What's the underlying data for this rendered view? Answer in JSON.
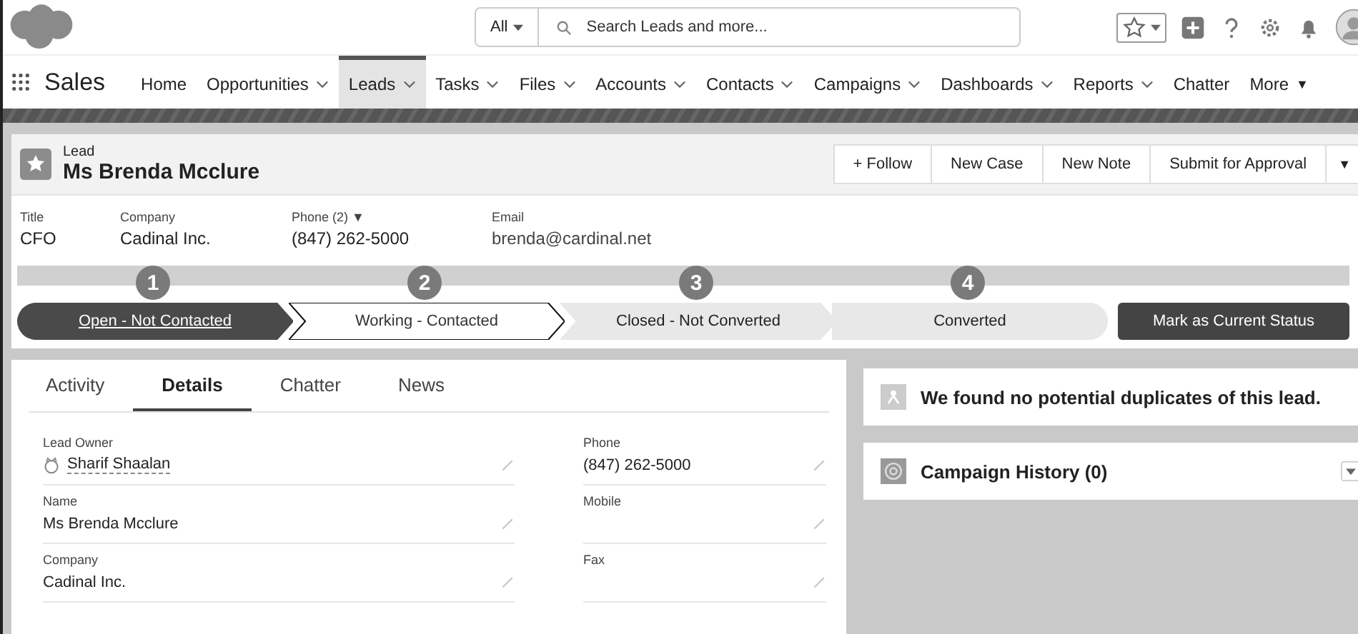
{
  "search": {
    "scope": "All",
    "placeholder": "Search Leads and more..."
  },
  "app_name": "Sales",
  "nav": [
    {
      "label": "Home",
      "menu": false,
      "selected": false
    },
    {
      "label": "Opportunities",
      "menu": true,
      "selected": false
    },
    {
      "label": "Leads",
      "menu": true,
      "selected": true
    },
    {
      "label": "Tasks",
      "menu": true,
      "selected": false
    },
    {
      "label": "Files",
      "menu": true,
      "selected": false
    },
    {
      "label": "Accounts",
      "menu": true,
      "selected": false
    },
    {
      "label": "Contacts",
      "menu": true,
      "selected": false
    },
    {
      "label": "Campaigns",
      "menu": true,
      "selected": false
    },
    {
      "label": "Dashboards",
      "menu": true,
      "selected": false
    },
    {
      "label": "Reports",
      "menu": true,
      "selected": false
    },
    {
      "label": "Chatter",
      "menu": false,
      "selected": false
    }
  ],
  "nav_more": {
    "label": "More",
    "caret": "▼"
  },
  "record": {
    "type": "Lead",
    "name": "Ms Brenda Mcclure",
    "actions": [
      "+ Follow",
      "New Case",
      "New Note",
      "Submit for Approval"
    ],
    "actions_caret": "▼"
  },
  "highlights": [
    {
      "label": "Title",
      "value": "CFO",
      "kind": "text"
    },
    {
      "label": "Company",
      "value": "Cadinal Inc.",
      "kind": "text"
    },
    {
      "label": "Phone (2) ▼",
      "value": "(847) 262-5000",
      "kind": "text"
    },
    {
      "label": "Email",
      "value": "brenda@cardinal.net",
      "kind": "link"
    }
  ],
  "callouts": [
    "1",
    "2",
    "3",
    "4"
  ],
  "path": [
    {
      "label": "Open - Not Contacted",
      "complete": true,
      "selected": false
    },
    {
      "label": "Working - Contacted",
      "complete": false,
      "selected": true
    },
    {
      "label": "Closed - Not Converted",
      "complete": false,
      "selected": false
    },
    {
      "label": "Converted",
      "complete": false,
      "selected": false
    }
  ],
  "path_button": "Mark as Current Status",
  "tabs": [
    {
      "label": "Activity",
      "selected": false
    },
    {
      "label": "Details",
      "selected": true
    },
    {
      "label": "Chatter",
      "selected": false
    },
    {
      "label": "News",
      "selected": false
    }
  ],
  "fields": [
    {
      "label": "Lead Owner",
      "value": "Sharif Shaalan",
      "kind": "user"
    },
    {
      "label": "Phone",
      "value": "(847) 262-5000",
      "kind": "text"
    },
    {
      "label": "Name",
      "value": "Ms Brenda Mcclure",
      "kind": "text"
    },
    {
      "label": "Mobile",
      "kind": "text"
    },
    {
      "label": "Company",
      "value": "Cadinal Inc.",
      "kind": "text"
    },
    {
      "label": "Fax",
      "kind": "text"
    }
  ],
  "duplicates": {
    "message": "We found no potential duplicates of this lead."
  },
  "campaign_history": {
    "title": "Campaign History (0)"
  }
}
